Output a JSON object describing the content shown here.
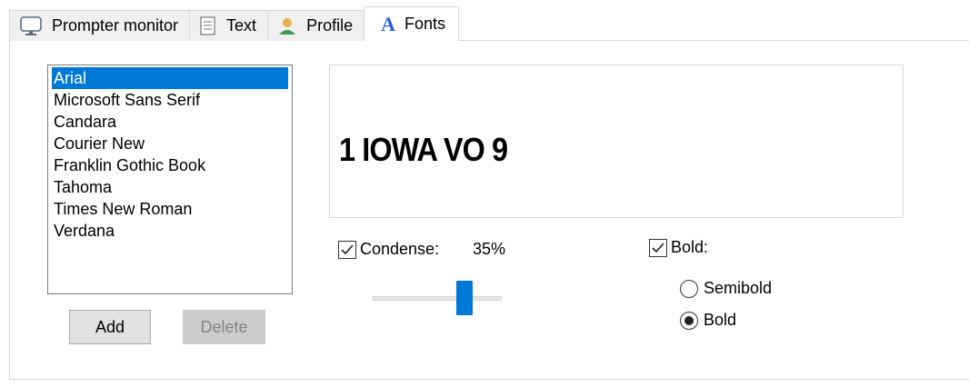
{
  "tabs": [
    {
      "label": "Prompter monitor",
      "icon": "monitor-icon",
      "active": false
    },
    {
      "label": "Text",
      "icon": "text-document-icon",
      "active": false
    },
    {
      "label": "Profile",
      "icon": "user-profile-icon",
      "active": false
    },
    {
      "label": "Fonts",
      "icon": "font-letter-icon",
      "active": true
    }
  ],
  "fonts": {
    "list": [
      "Arial",
      "Microsoft Sans Serif",
      "Candara",
      "Courier New",
      "Franklin Gothic Book",
      "Tahoma",
      "Times New Roman",
      "Verdana"
    ],
    "selected_index": 0,
    "add_label": "Add",
    "delete_label": "Delete"
  },
  "preview": {
    "sample_text": "1 IOWA VO 9"
  },
  "condense": {
    "label": "Condense:",
    "checked": true,
    "value_text": "35%",
    "value": 35
  },
  "bold": {
    "label": "Bold:",
    "checked": true,
    "options": [
      {
        "label": "Semibold",
        "selected": false
      },
      {
        "label": "Bold",
        "selected": true
      }
    ]
  },
  "colors": {
    "accent": "#0078d7",
    "icon_blue": "#2b5fd9"
  }
}
